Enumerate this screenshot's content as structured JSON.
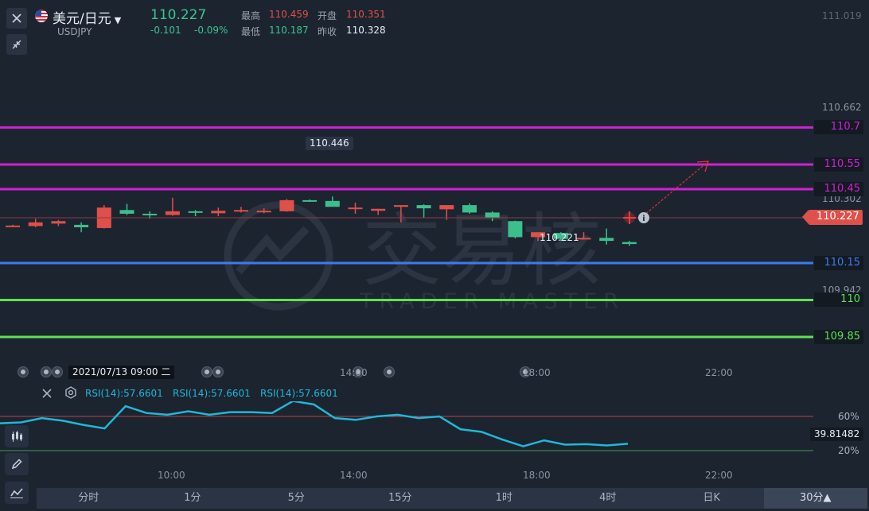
{
  "header": {
    "pair_name": "美元/日元",
    "symbol": "USDJPY",
    "price": "110.227",
    "change": "-0.101",
    "change_pct": "-0.09%",
    "high_label": "最高",
    "high_value": "110.459",
    "open_label": "开盘",
    "open_value": "110.351",
    "low_label": "最低",
    "low_value": "110.187",
    "prev_close_label": "昨收",
    "prev_close_value": "110.328"
  },
  "price_axis": {
    "top_label": "111.019",
    "labels": [
      "110.662",
      "110.302",
      "109.942"
    ],
    "current_price_tag": "110.227"
  },
  "levels": [
    {
      "label": "110.7",
      "color": "#d21fd6"
    },
    {
      "label": "110.55",
      "color": "#d21fd6"
    },
    {
      "label": "110.45",
      "color": "#d21fd6"
    },
    {
      "label": "110.15",
      "color": "#3b7cf2"
    },
    {
      "label": "110",
      "color": "#5fe055"
    },
    {
      "label": "109.85",
      "color": "#5fe055"
    }
  ],
  "annotations": {
    "high_marker": "110.446",
    "low_marker": "110.221"
  },
  "watermark": {
    "cn": "交易核",
    "en": "TRADER MASTER"
  },
  "crosshair": {
    "date_label": "2021/07/13 09:00 二"
  },
  "time_axis_main": [
    "14:00",
    "18:00",
    "22:00"
  ],
  "rsi": {
    "legend": [
      "RSI(14):57.6601",
      "RSI(14):57.6601",
      "RSI(14):57.6601"
    ],
    "level_high": "60%",
    "level_low": "20%",
    "current_value": "39.81482",
    "color": "#1fb8d8"
  },
  "time_axis_bottom": [
    "10:00",
    "14:00",
    "18:00",
    "22:00"
  ],
  "timeframes": [
    "分时",
    "1分",
    "5分",
    "15分",
    "1时",
    "4时",
    "日K",
    "30分▲"
  ],
  "active_timeframe": "30分▲",
  "colors": {
    "up": "#e0504a",
    "down": "#3cbf8c",
    "background": "#1c2430"
  },
  "chart_data": {
    "type": "candlestick",
    "candles": [
      {
        "o": 110.302,
        "h": 110.305,
        "l": 110.298,
        "c": 110.302
      },
      {
        "o": 110.3,
        "h": 110.33,
        "l": 110.295,
        "c": 110.315
      },
      {
        "o": 110.31,
        "h": 110.325,
        "l": 110.3,
        "c": 110.32
      },
      {
        "o": 110.305,
        "h": 110.315,
        "l": 110.275,
        "c": 110.295
      },
      {
        "o": 110.292,
        "h": 110.385,
        "l": 110.29,
        "c": 110.375
      },
      {
        "o": 110.365,
        "h": 110.39,
        "l": 110.345,
        "c": 110.35
      },
      {
        "o": 110.35,
        "h": 110.36,
        "l": 110.33,
        "c": 110.345
      },
      {
        "o": 110.345,
        "h": 110.415,
        "l": 110.342,
        "c": 110.36
      },
      {
        "o": 110.36,
        "h": 110.365,
        "l": 110.34,
        "c": 110.355
      },
      {
        "o": 110.352,
        "h": 110.375,
        "l": 110.34,
        "c": 110.362
      },
      {
        "o": 110.365,
        "h": 110.378,
        "l": 110.355,
        "c": 110.365
      },
      {
        "o": 110.36,
        "h": 110.372,
        "l": 110.352,
        "c": 110.362
      },
      {
        "o": 110.36,
        "h": 110.41,
        "l": 110.358,
        "c": 110.405
      },
      {
        "o": 110.405,
        "h": 110.408,
        "l": 110.398,
        "c": 110.4
      },
      {
        "o": 110.402,
        "h": 110.42,
        "l": 110.38,
        "c": 110.378
      },
      {
        "o": 110.375,
        "h": 110.395,
        "l": 110.35,
        "c": 110.375
      },
      {
        "o": 110.362,
        "h": 110.37,
        "l": 110.345,
        "c": 110.37
      },
      {
        "o": 110.378,
        "h": 110.38,
        "l": 110.315,
        "c": 110.385
      },
      {
        "o": 110.385,
        "h": 110.388,
        "l": 110.332,
        "c": 110.372
      },
      {
        "o": 110.368,
        "h": 110.385,
        "l": 110.325,
        "c": 110.385
      },
      {
        "o": 110.385,
        "h": 110.392,
        "l": 110.35,
        "c": 110.355
      },
      {
        "o": 110.355,
        "h": 110.36,
        "l": 110.32,
        "c": 110.335
      },
      {
        "o": 110.32,
        "h": 110.322,
        "l": 110.25,
        "c": 110.255
      },
      {
        "o": 110.255,
        "h": 110.268,
        "l": 110.24,
        "c": 110.275
      },
      {
        "o": 110.272,
        "h": 110.275,
        "l": 110.24,
        "c": 110.248
      },
      {
        "o": 110.25,
        "h": 110.275,
        "l": 110.245,
        "c": 110.252
      },
      {
        "o": 110.252,
        "h": 110.29,
        "l": 110.225,
        "c": 110.24
      },
      {
        "o": 110.235,
        "h": 110.24,
        "l": 110.22,
        "c": 110.227
      }
    ],
    "ylim": [
      109.75,
      111.04
    ],
    "x_ticks": [
      "14:00",
      "18:00",
      "22:00"
    ],
    "rsi_values": [
      52,
      53,
      58,
      55,
      50,
      46,
      72,
      64,
      62,
      66,
      62,
      65,
      65,
      64,
      78,
      74,
      58,
      56,
      60,
      62,
      58,
      60,
      45,
      42,
      33,
      25,
      32,
      27,
      27.5,
      26,
      28
    ]
  }
}
